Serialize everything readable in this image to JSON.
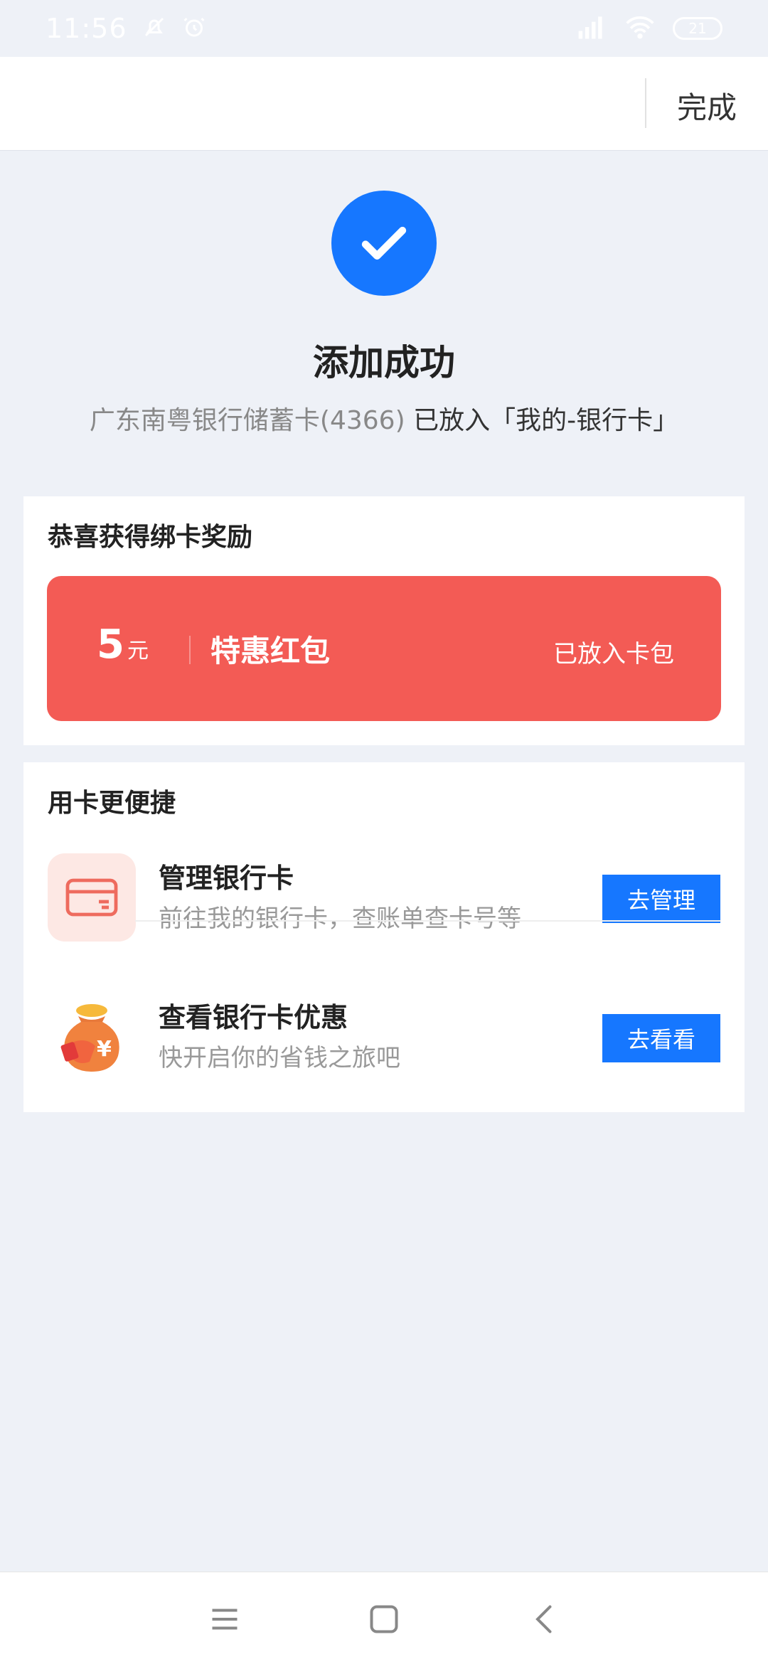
{
  "status_bar": {
    "time": "11:56",
    "battery": "21"
  },
  "top_bar": {
    "done_label": "完成"
  },
  "result": {
    "title": "添加成功",
    "card_name": "广东南粤银行储蓄卡(4366)",
    "placed_text": "已放入「我的-银行卡」"
  },
  "reward": {
    "title": "恭喜获得绑卡奖励",
    "amount": "5",
    "unit": "元",
    "name": "特惠红包",
    "status": "已放入卡包"
  },
  "convenience": {
    "title": "用卡更便捷",
    "items": [
      {
        "title": "管理银行卡",
        "desc": "前往我的银行卡，查账单查卡号等",
        "button": "去管理",
        "icon": "bank-card-icon"
      },
      {
        "title": "查看银行卡优惠",
        "desc": "快开启你的省钱之旅吧",
        "button": "去看看",
        "icon": "money-bag-icon"
      }
    ]
  },
  "colors": {
    "accent": "#1677ff",
    "red_packet": "#f35b55",
    "background": "#eef1f7"
  }
}
